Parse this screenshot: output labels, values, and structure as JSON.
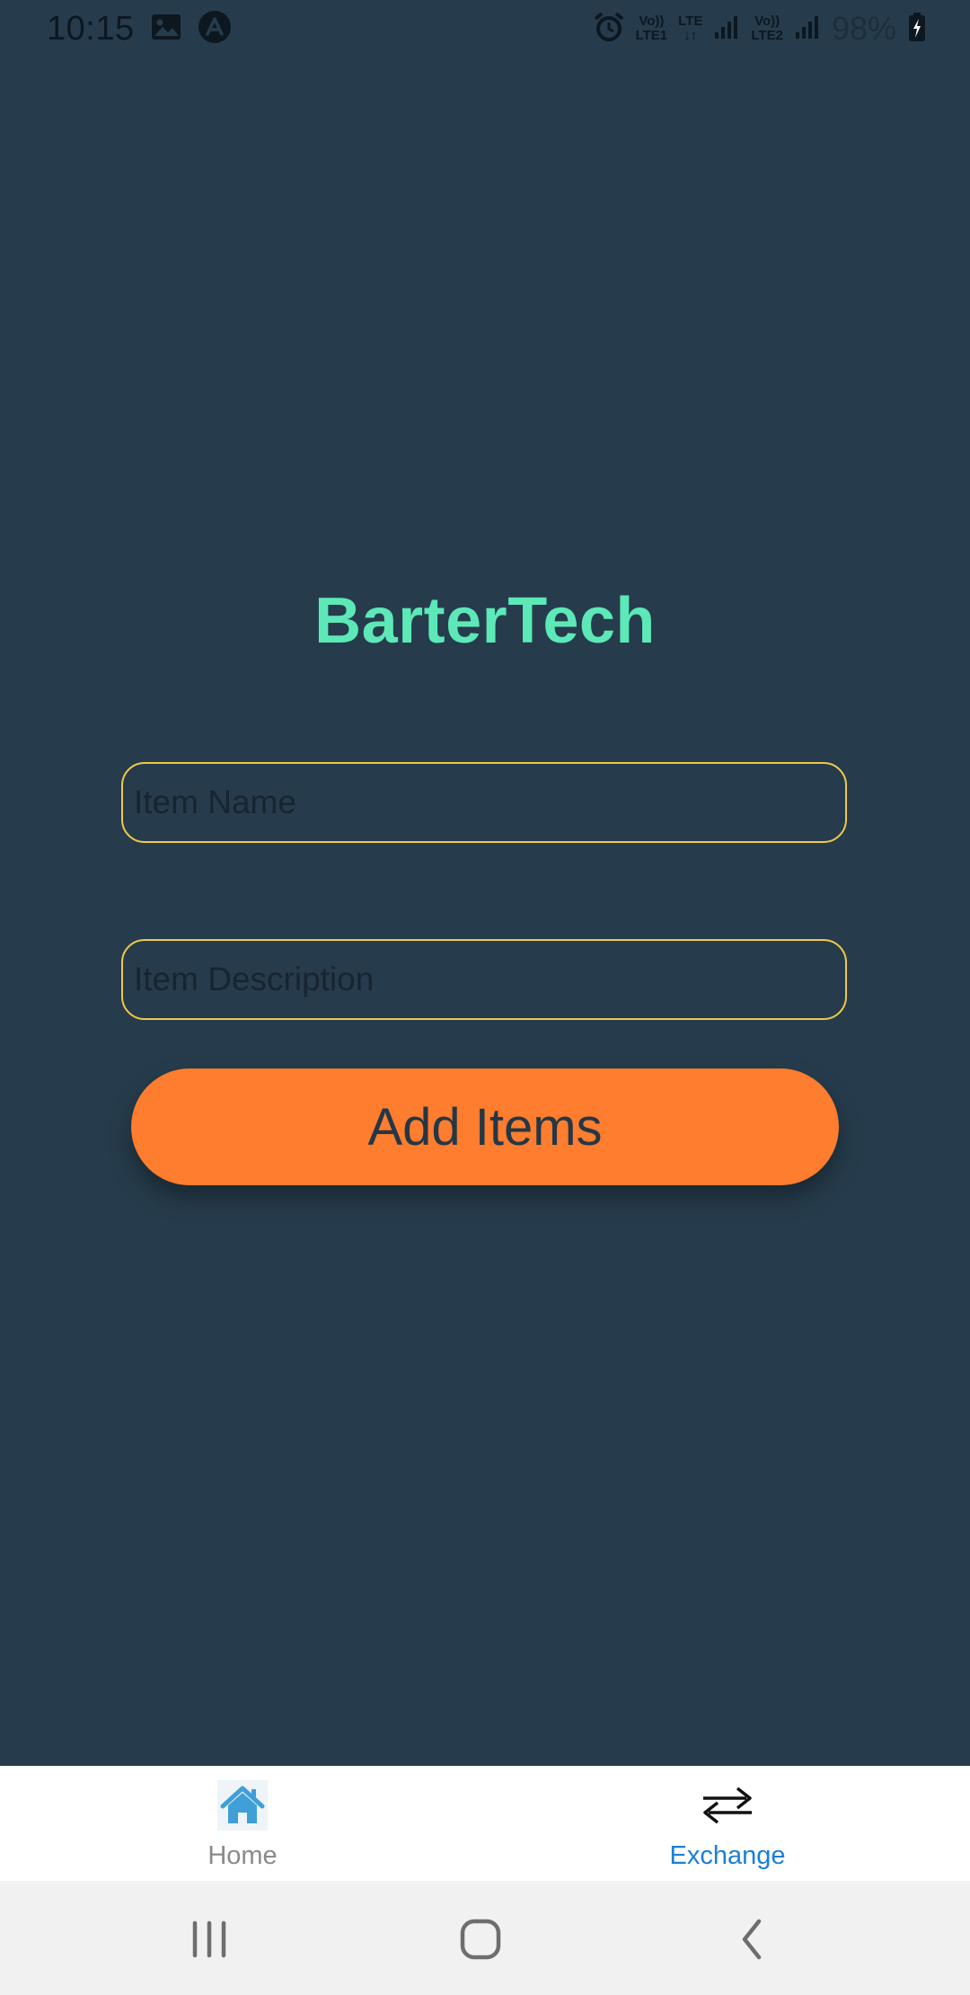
{
  "status_bar": {
    "time": "10:15",
    "network_1": {
      "top": "Vo))",
      "bottom": "LTE1"
    },
    "network_lte": {
      "top": "LTE",
      "bottom": "↓↑"
    },
    "network_2": {
      "top": "Vo))",
      "bottom": "LTE2"
    },
    "battery": "98%",
    "icons": [
      "gallery-icon",
      "app-notification-icon",
      "alarm-icon",
      "signal-icon",
      "battery-charging-icon"
    ]
  },
  "main": {
    "title": "BarterTech",
    "item_name_placeholder": "Item Name",
    "item_description_placeholder": "Item Description",
    "add_button_label": "Add Items"
  },
  "tabs": [
    {
      "label": "Home",
      "icon": "home-icon",
      "active": false
    },
    {
      "label": "Exchange",
      "icon": "exchange-arrows-icon",
      "active": true
    }
  ],
  "colors": {
    "background": "#263c4c",
    "title": "#5de8b8",
    "field_border": "#f0c94a",
    "button": "#fe7d2e",
    "active_tab": "#1a7fd6",
    "inactive_tab": "#8a8a8a"
  }
}
